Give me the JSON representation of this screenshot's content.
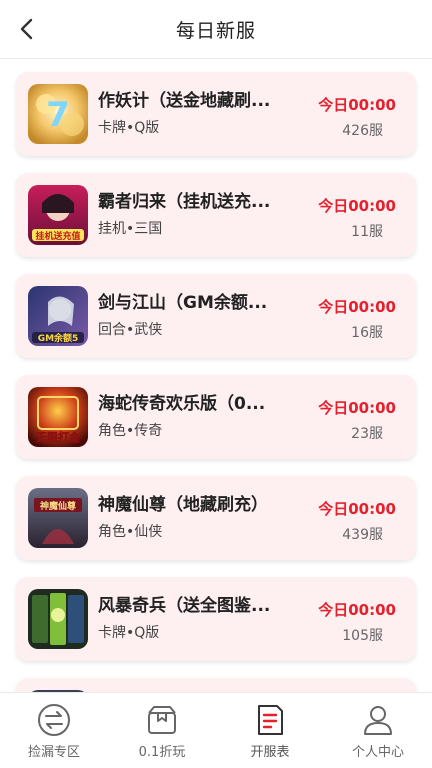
{
  "header": {
    "title": "每日新服"
  },
  "colors": {
    "accent": "#e5212d",
    "card_bg": "#fef0f1"
  },
  "games": [
    {
      "name": "作妖计（送金地藏刷...",
      "tags": "卡牌•Q版",
      "time": "今日00:00",
      "server": "426服"
    },
    {
      "name": "霸者归来（挂机送充...",
      "tags": "挂机•三国",
      "time": "今日00:00",
      "server": "11服"
    },
    {
      "name": "剑与江山（GM余额...",
      "tags": "回合•武侠",
      "time": "今日00:00",
      "server": "16服"
    },
    {
      "name": "海蛇传奇欢乐版（0...",
      "tags": "角色•传奇",
      "time": "今日00:00",
      "server": "23服"
    },
    {
      "name": "神魔仙尊（地藏刷充）",
      "tags": "角色•仙侠",
      "time": "今日00:00",
      "server": "439服"
    },
    {
      "name": "风暴奇兵（送全图鉴...",
      "tags": "卡牌•Q版",
      "time": "今日00:00",
      "server": "105服"
    }
  ],
  "icon_text": {
    "g1": "7",
    "g2": "挂机送充值",
    "g3": "GM余额5",
    "g4": "无限打金",
    "g5": "神魔仙尊"
  },
  "tabs": [
    {
      "label": "捡漏专区",
      "icon": "exchange-icon"
    },
    {
      "label": "0.1折玩",
      "icon": "gift-box-icon"
    },
    {
      "label": "开服表",
      "icon": "document-list-icon"
    },
    {
      "label": "个人中心",
      "icon": "user-icon"
    }
  ]
}
